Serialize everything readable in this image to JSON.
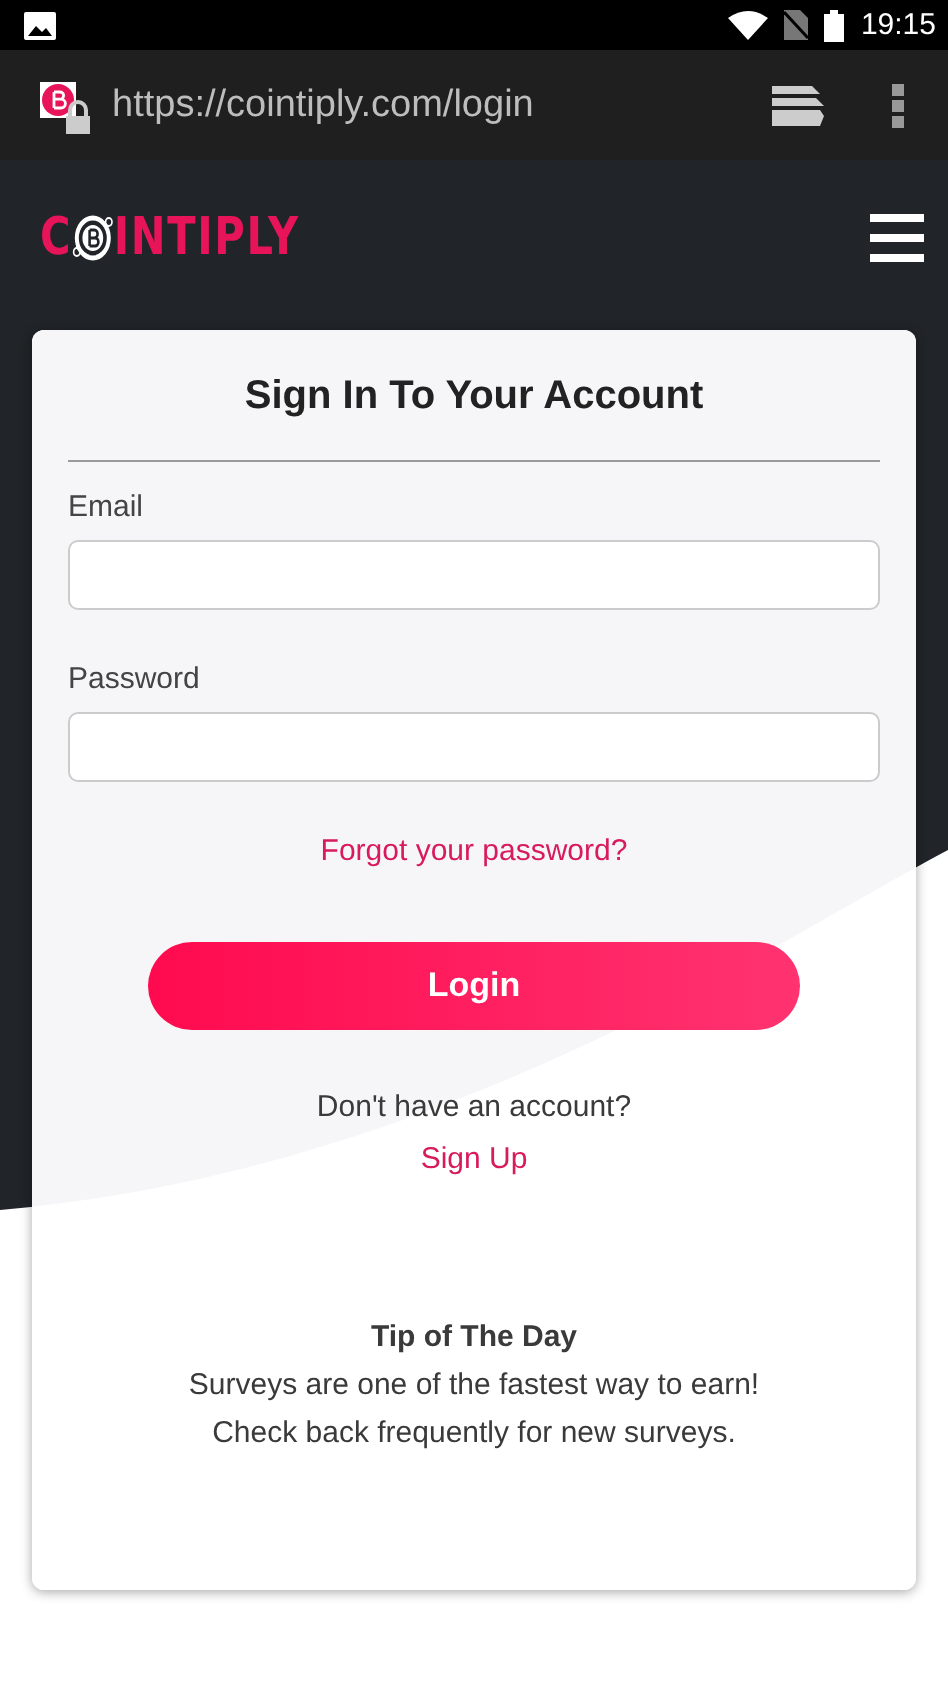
{
  "status_bar": {
    "time": "19:15"
  },
  "browser": {
    "url": "https://cointiply.com/login"
  },
  "header": {
    "logo_left": "C",
    "logo_right": "INTIPLY"
  },
  "login_card": {
    "title": "Sign In To Your Account",
    "fields": [
      {
        "label": "Email"
      },
      {
        "label": "Password"
      }
    ],
    "forgot_link": "Forgot your password?",
    "login_button": "Login",
    "signup_prompt": "Don't have an account?",
    "signup_link": "Sign Up",
    "tip_title": "Tip of The Day",
    "tip_lines": [
      "Surveys are one of the fastest way to earn!",
      "Check back frequently for new surveys."
    ]
  }
}
